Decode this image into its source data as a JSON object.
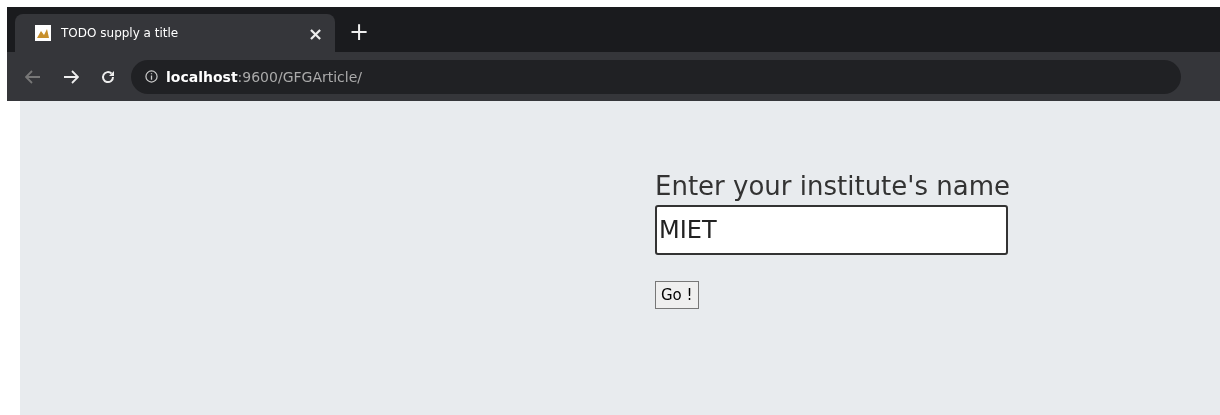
{
  "tabs": [
    {
      "title": "TODO supply a title",
      "close": "×",
      "selected": true
    }
  ],
  "new_tab": "+",
  "address_bar": {
    "host": "localhost",
    "path": ":9600/GFGArticle/"
  },
  "page": {
    "label": "Enter your institute's name",
    "input": {
      "value": "MIET"
    },
    "button": "Go !"
  }
}
